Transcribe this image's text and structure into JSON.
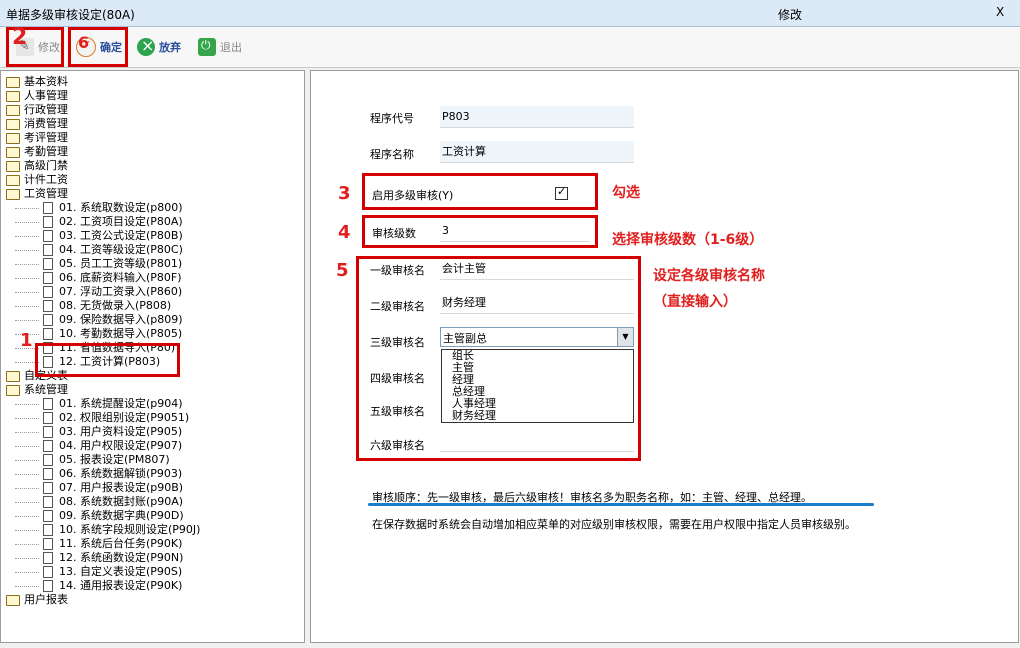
{
  "window": {
    "title": "单据多级审核设定(80A)",
    "mode": "修改",
    "close": "X"
  },
  "toolbar": {
    "edit": "修改",
    "confirm": "确定",
    "cancel": "放弃",
    "exit": "退出"
  },
  "tree": {
    "top_folders_1": [
      "基本资料",
      "人事管理",
      "行政管理",
      "消费管理",
      "考评管理",
      "考勤管理",
      "高级门禁",
      "计件工资",
      "工资管理"
    ],
    "payroll_items": [
      "01. 系统取数设定(p800)",
      "02. 工资项目设定(P80A)",
      "03. 工资公式设定(P80B)",
      "04. 工资等级设定(P80C)",
      "05. 员工工资等级(P801)",
      "06. 底薪资料输入(P80F)",
      "07. 浮动工资录入(P860)",
      "08. 无货做录入(P808)",
      "09. 保险数据导入(p809)",
      "10. 考勤数据导入(P805)",
      "11. 省值数据导入(P80)",
      "12. 工资计算(P803)"
    ],
    "folders_2": [
      "自定义表",
      "系统管理"
    ],
    "system_items": [
      "01. 系统提醒设定(p904)",
      "02. 权限组别设定(P9051)",
      "03. 用户资料设定(P905)",
      "04. 用户权限设定(P907)",
      "05. 报表设定(PM807)",
      "06. 系统数据解锁(P903)",
      "07. 用户报表设定(p90B)",
      "08. 系统数据封账(p90A)",
      "09. 系统数据字典(P90D)",
      "10. 系统字段规则设定(P90J)",
      "11. 系统后台任务(P90K)",
      "12. 系统函数设定(P90N)",
      "13. 自定义表设定(P90S)",
      "14. 通用报表设定(P90K)"
    ],
    "last_folder": "用户报表"
  },
  "form": {
    "program_code_label": "程序代号",
    "program_code": "P803",
    "program_name_label": "程序名称",
    "program_name": "工资计算",
    "enable_label": "启用多级审核(Y)",
    "enabled": true,
    "levels_label": "审核级数",
    "levels": "3",
    "level_labels": [
      "一级审核名",
      "二级审核名",
      "三级审核名",
      "四级审核名",
      "五级审核名",
      "六级审核名"
    ],
    "level_values": [
      "会计主管",
      "财务经理",
      "主管副总",
      "",
      "",
      ""
    ],
    "dropdown_options": [
      "组长",
      "主管",
      "经理",
      "总经理",
      "人事经理",
      "财务经理"
    ]
  },
  "annotations": {
    "n1": "1",
    "n2": "2",
    "n3": "3",
    "n4": "4",
    "n5": "5",
    "n6": "6",
    "check_hint": "勾选",
    "levels_hint": "选择审核级数（1-6级）",
    "names_hint_1": "设定各级审核名称",
    "names_hint_2": "（直接输入）"
  },
  "notes": {
    "line1": "审核顺序：先一级审核，最后六级审核！审核名多为职务名称，如：主管、经理、总经理。",
    "line2": "在保存数据时系统会自动增加相应菜单的对应级别审核权限，需要在用户权限中指定人员审核级别。"
  },
  "colors": {
    "annotation": "#e02020",
    "underline": "#1a7dc9"
  }
}
